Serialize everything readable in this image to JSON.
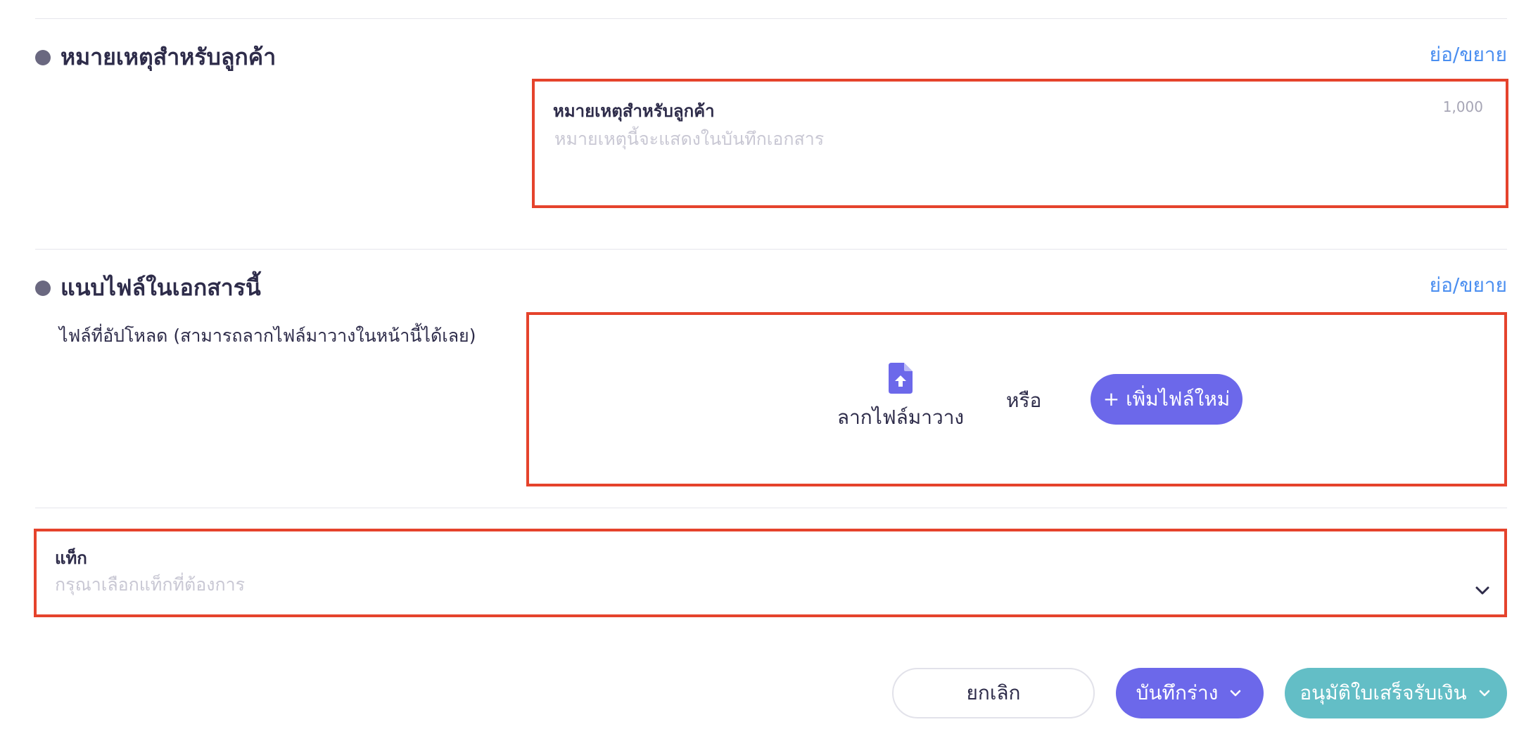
{
  "customer_note_section": {
    "title": "หมายเหตุสำหรับลูกค้า",
    "toggle_label": "ย่อ/ขยาย",
    "field_label": "หมายเหตุสำหรับลูกค้า",
    "char_limit": "1,000",
    "placeholder": "หมายเหตุนี้จะแสดงในบันทึกเอกสาร"
  },
  "attachment_section": {
    "title": "แนบไฟล์ในเอกสารนี้",
    "toggle_label": "ย่อ/ขยาย",
    "hint": "ไฟล์ที่อัปโหลด (สามารถลากไฟล์มาวางในหน้านี้ได้เลย)",
    "drop_label": "ลากไฟล์มาวาง",
    "or_label": "หรือ",
    "add_file_label": "+ เพิ่มไฟล์ใหม่",
    "icon": "file-upload-icon"
  },
  "tag_field": {
    "label": "แท็ก",
    "placeholder": "กรุณาเลือกแท็กที่ต้องการ",
    "icon": "chevron-down-icon"
  },
  "actions": {
    "cancel_label": "ยกเลิก",
    "save_draft_label": "บันทึกร่าง",
    "approve_label": "อนุมัติใบเสร็จรับเงิน"
  },
  "colors": {
    "primary": "#6c68ea",
    "approve": "#63bec6",
    "link": "#4a8ef0",
    "highlight_border": "#e5432c"
  }
}
